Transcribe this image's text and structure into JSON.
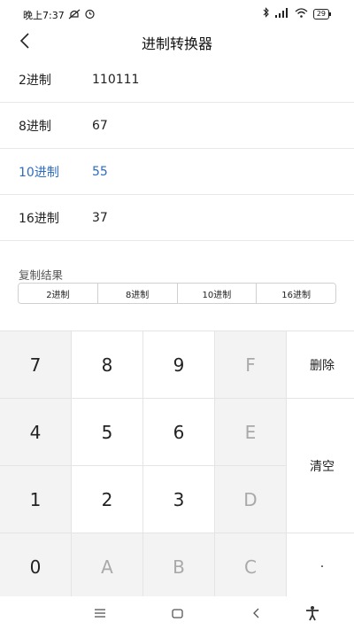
{
  "status_bar": {
    "time": "晚上7:37",
    "battery": "29"
  },
  "app_bar": {
    "title": "进制转换器"
  },
  "rows": [
    {
      "label": "2进制",
      "value": "110111",
      "active": false
    },
    {
      "label": "8进制",
      "value": "67",
      "active": false
    },
    {
      "label": "10进制",
      "value": "55",
      "active": true
    },
    {
      "label": "16进制",
      "value": "37",
      "active": false
    }
  ],
  "copy": {
    "title": "复制结果",
    "buttons": [
      "2进制",
      "8进制",
      "10进制",
      "16进制"
    ]
  },
  "keypad": {
    "k7": "7",
    "k8": "8",
    "k9": "9",
    "kF": "F",
    "delete": "删除",
    "k4": "4",
    "k5": "5",
    "k6": "6",
    "kE": "E",
    "clear": "清空",
    "k1": "1",
    "k2": "2",
    "k3": "3",
    "kD": "D",
    "k0": "0",
    "kA": "A",
    "kB": "B",
    "kC": "C",
    "dot": "·"
  },
  "colors": {
    "accent": "#2d6cc0",
    "disabled": "#a9a9a9"
  }
}
